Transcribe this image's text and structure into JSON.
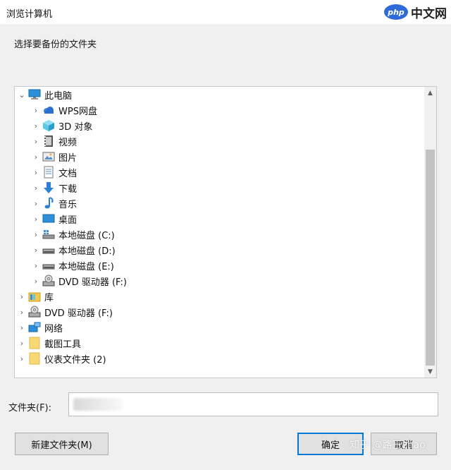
{
  "window": {
    "title": "浏览计算机"
  },
  "watermark_top": {
    "logo": "php",
    "text": "中文网"
  },
  "prompt": "选择要备份的文件夹",
  "tree": {
    "items": [
      {
        "label": "此电脑",
        "icon": "computer-icon",
        "expanded": true
      },
      {
        "label": "WPS网盘",
        "icon": "cloud-drive-icon"
      },
      {
        "label": "3D 对象",
        "icon": "3d-objects-icon"
      },
      {
        "label": "视频",
        "icon": "video-icon"
      },
      {
        "label": "图片",
        "icon": "pictures-icon"
      },
      {
        "label": "文档",
        "icon": "documents-icon"
      },
      {
        "label": "下载",
        "icon": "download-icon"
      },
      {
        "label": "音乐",
        "icon": "music-icon"
      },
      {
        "label": "桌面",
        "icon": "desktop-icon"
      },
      {
        "label": "本地磁盘 (C:)",
        "icon": "system-drive-icon"
      },
      {
        "label": "本地磁盘 (D:)",
        "icon": "drive-icon"
      },
      {
        "label": "本地磁盘 (E:)",
        "icon": "drive-icon"
      },
      {
        "label": "DVD 驱动器 (F:)",
        "icon": "dvd-drive-icon"
      },
      {
        "label": "库",
        "icon": "library-icon"
      },
      {
        "label": "DVD 驱动器 (F:)",
        "icon": "dvd-drive-icon"
      },
      {
        "label": "网络",
        "icon": "network-icon"
      },
      {
        "label": "截图工具",
        "icon": "folder-icon"
      },
      {
        "label": "仪表文件夹 (2)",
        "icon": "folder-icon"
      }
    ]
  },
  "folder_field": {
    "label": "文件夹(F):"
  },
  "buttons": {
    "new_folder": "新建文件夹(M)",
    "ok": "确定",
    "cancel": "取消"
  },
  "watermark_bottom": "知乎 @路王zhao"
}
